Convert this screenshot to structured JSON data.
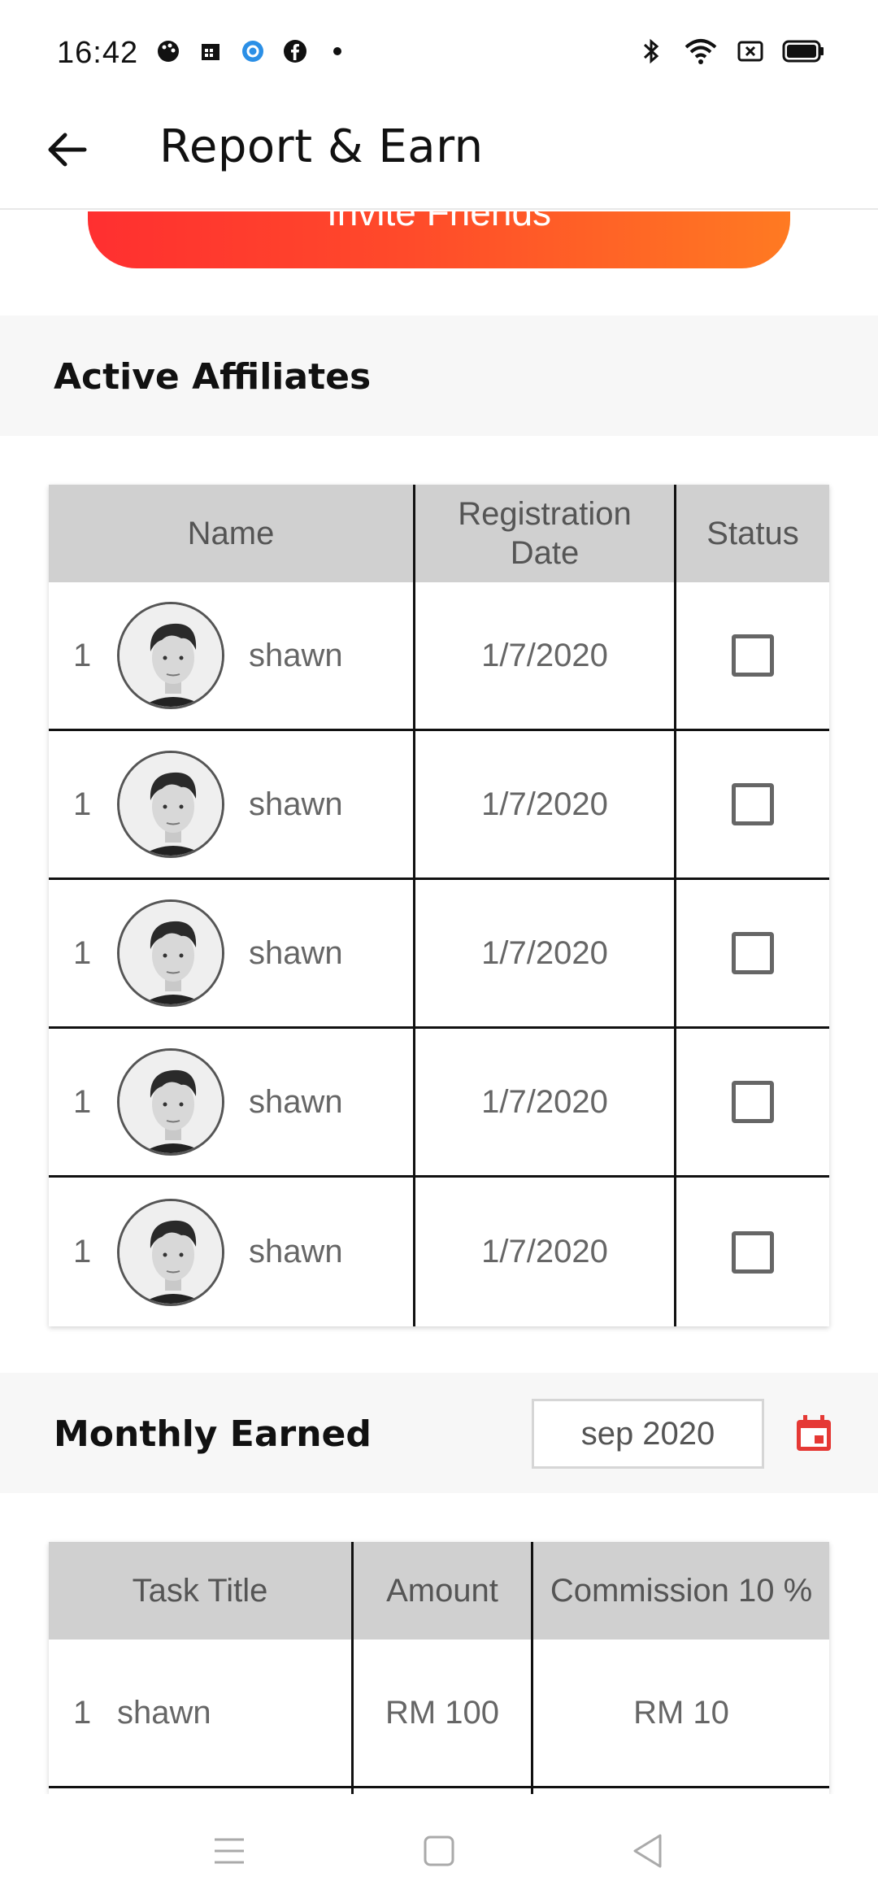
{
  "status_bar": {
    "time": "16:42",
    "left_icons": [
      "palette-icon",
      "calendar-grid-icon",
      "circle-target-icon",
      "facebook-icon",
      "dot-icon"
    ],
    "right_icons": [
      "bluetooth-icon",
      "wifi-icon",
      "sim-off-icon",
      "battery-icon"
    ]
  },
  "app_bar": {
    "title": "Report & Earn",
    "back_icon": "arrow-left-icon"
  },
  "invite_button": {
    "label": "Invite Friends",
    "gradient": [
      "#ff2f30",
      "#ff7a22"
    ]
  },
  "affiliates": {
    "section_title": "Active Affiliates",
    "headers": {
      "name": "Name",
      "date": "Registration Date",
      "status": "Status"
    },
    "rows": [
      {
        "num": "1",
        "name": "shawn",
        "date": "1/7/2020",
        "status": false
      },
      {
        "num": "1",
        "name": "shawn",
        "date": "1/7/2020",
        "status": false
      },
      {
        "num": "1",
        "name": "shawn",
        "date": "1/7/2020",
        "status": false
      },
      {
        "num": "1",
        "name": "shawn",
        "date": "1/7/2020",
        "status": false
      },
      {
        "num": "1",
        "name": "shawn",
        "date": "1/7/2020",
        "status": false
      }
    ]
  },
  "monthly": {
    "section_title": "Monthly Earned",
    "date_value": "sep 2020",
    "calendar_icon": "calendar-icon",
    "accent": "#e53935",
    "headers": {
      "task": "Task Title",
      "amount": "Amount",
      "commission": "Commission 10 %"
    },
    "rows": [
      {
        "num": "1",
        "task": "shawn",
        "amount": "RM 100",
        "commission": "RM 10"
      }
    ]
  },
  "bottom_nav": [
    "menu-icon",
    "home-square-icon",
    "back-triangle-icon"
  ]
}
